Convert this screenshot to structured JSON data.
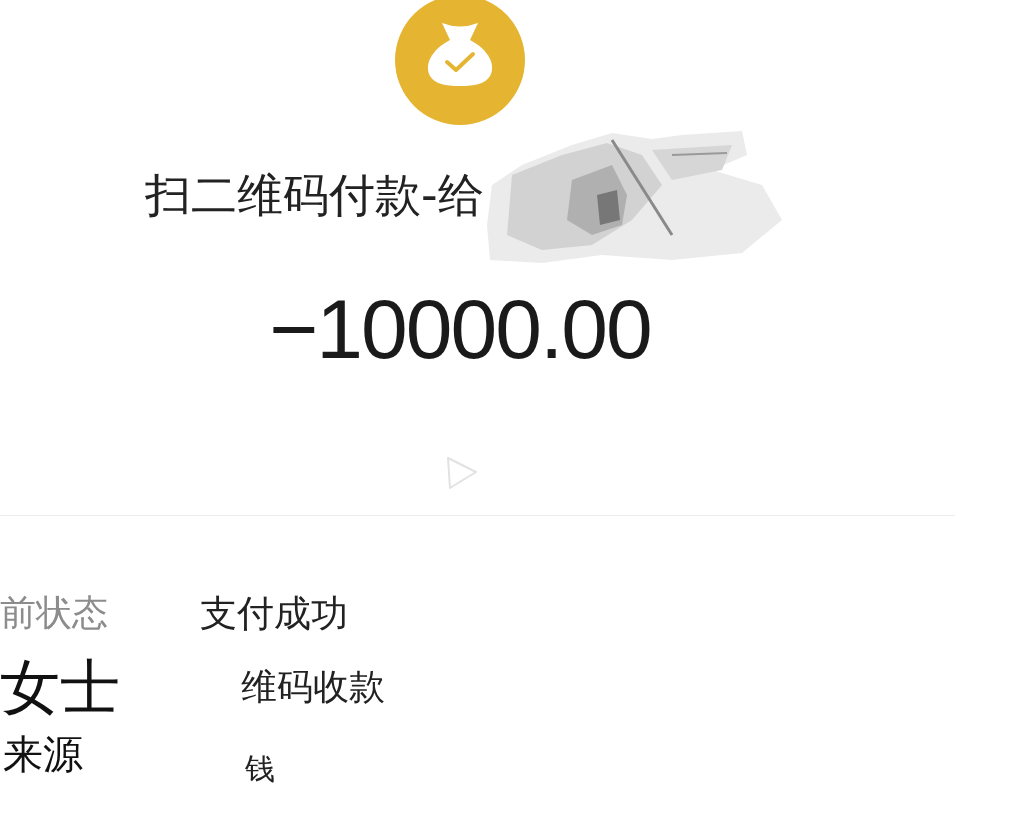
{
  "transaction": {
    "title": "扫二维码付款-给",
    "payee_redacted": true,
    "amount": "−10000.00"
  },
  "details": [
    {
      "label": "前状态",
      "value": "支付成功"
    },
    {
      "label": "女士",
      "value": "维码收款"
    },
    {
      "label": "来源",
      "value": "钱"
    }
  ]
}
